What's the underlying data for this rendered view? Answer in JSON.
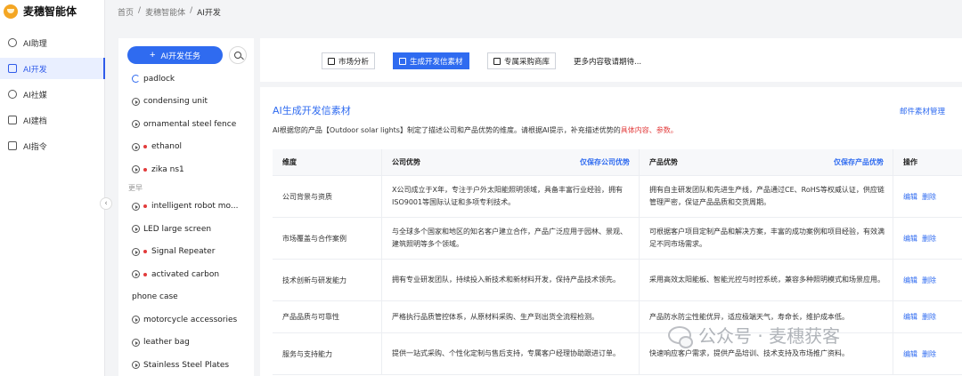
{
  "app": {
    "name": "麦穗智能体"
  },
  "nav": [
    {
      "label": "AI助理",
      "icon": "chat-icon"
    },
    {
      "label": "AI开发",
      "icon": "document-icon",
      "active": true
    },
    {
      "label": "AI社媒",
      "icon": "social-icon"
    },
    {
      "label": "AI建档",
      "icon": "archive-icon"
    },
    {
      "label": "AI指令",
      "icon": "flag-icon"
    }
  ],
  "breadcrumb": [
    "首页",
    "麦穗智能体",
    "AI开发"
  ],
  "task_panel": {
    "new_task_label": "AI开发任务",
    "group_label": "更早",
    "tasks": [
      {
        "name": "padlock",
        "status": "loading"
      },
      {
        "name": "condensing unit"
      },
      {
        "name": "ornamental steel fence"
      },
      {
        "name": "ethanol",
        "badge": "red-dot"
      },
      {
        "name": "zika ns1",
        "badge": "red-dot"
      },
      {
        "name": "intelligent robot mo...",
        "badge": "red-dot"
      },
      {
        "name": "LED large screen"
      },
      {
        "name": "Signal Repeater",
        "badge": "red-dot"
      },
      {
        "name": "activated carbon",
        "badge": "red-dot"
      },
      {
        "name": "phone case"
      },
      {
        "name": "motorcycle accessories"
      },
      {
        "name": "leather bag"
      },
      {
        "name": "Stainless Steel Plates"
      }
    ]
  },
  "tabs": [
    {
      "label": "市场分析"
    },
    {
      "label": "生成开发信素材",
      "active": true
    },
    {
      "label": "专属采购商库"
    }
  ],
  "tab_more": "更多内容敬请期待...",
  "main": {
    "title": "AI生成开发信素材",
    "mail_link": "邮件素材管理",
    "desc_prefix": "AI根据您的产品【Outdoor solar lights】制定了描述公司和产品优势的维度。请根据AI提示，补充描述优势的",
    "desc_highlight": "具体内容、参数。",
    "table": {
      "headers": {
        "dimension": "维度",
        "company": "公司优势",
        "company_save": "仅保存公司优势",
        "product": "产品优势",
        "product_save": "仅保存产品优势",
        "actions": "操作"
      },
      "edit_label": "编辑",
      "delete_label": "删除",
      "rows": [
        {
          "dimension": "公司背景与资质",
          "company": "X公司成立于X年，专注于户外太阳能照明领域，具备丰富行业经验，拥有ISO9001等国际认证和多项专利技术。",
          "product": "拥有自主研发团队和先进生产线，产品通过CE、RoHS等权威认证，供应链管理严密，保证产品品质和交货周期。"
        },
        {
          "dimension": "市场覆盖与合作案例",
          "company": "与全球多个国家和地区的知名客户建立合作，产品广泛应用于园林、景观、建筑照明等多个领域。",
          "product": "可根据客户项目定制产品和解决方案，丰富的成功案例和项目经验，有效满足不同市场需求。"
        },
        {
          "dimension": "技术创新与研发能力",
          "company": "拥有专业研发团队，持续投入新技术和新材料开发，保持产品技术领先。",
          "product": "采用高效太阳能板、智能光控与时控系统，兼容多种照明模式和场景应用。"
        },
        {
          "dimension": "产品品质与可靠性",
          "company": "严格执行品质管控体系，从原材料采购、生产到出货全流程检测。",
          "product": "产品防水防尘性能优异，适应极端天气，寿命长，维护成本低。"
        },
        {
          "dimension": "服务与支持能力",
          "company": "提供一站式采购、个性化定制与售后支持，专属客户经理协助跟进订单。",
          "product": "快速响应客户需求，提供产品培训、技术支持及市场推广资料。"
        }
      ]
    }
  },
  "watermark": "公众号 · 麦穗获客"
}
